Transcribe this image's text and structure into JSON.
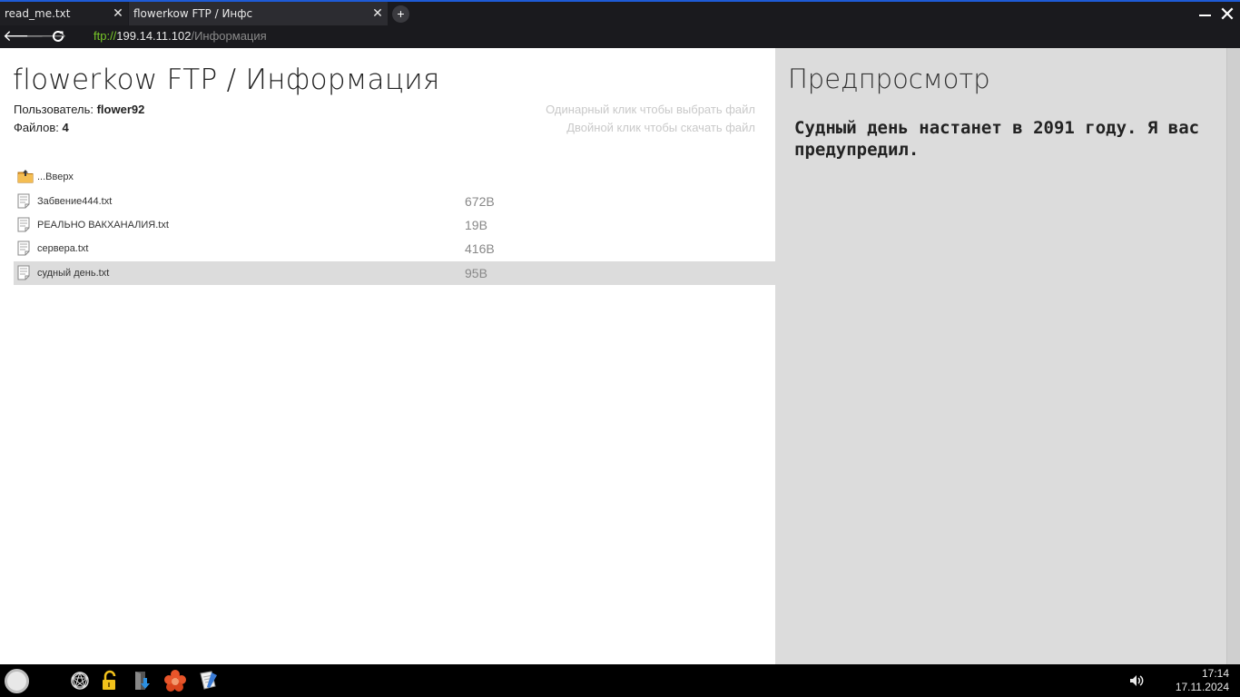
{
  "browser": {
    "tabs": [
      {
        "label": "read_me.txt",
        "active": false
      },
      {
        "label": "flowerkow FTP / Инфс",
        "active": true
      }
    ],
    "new_tab_symbol": "+",
    "close_symbol": "✕",
    "address": {
      "scheme": "ftp://",
      "host": "199.14.11.102",
      "path": "/Информация"
    }
  },
  "page": {
    "title": "flowerkow FTP / Информация",
    "user_label": "Пользователь: ",
    "user_value": "flower92",
    "files_label": "Файлов: ",
    "files_value": "4",
    "hint_single": "Одинарный клик чтобы выбрать файл",
    "hint_double": "Двойной клик чтобы скачать файл",
    "files": [
      {
        "name": "...Вверх",
        "size": "",
        "type": "up",
        "selected": false
      },
      {
        "name": "Забвение444.txt",
        "size": "672B",
        "type": "file",
        "selected": false
      },
      {
        "name": "РЕАЛЬНО ВАКХАНАЛИЯ.txt",
        "size": "19B",
        "type": "file",
        "selected": false
      },
      {
        "name": "сервера.txt",
        "size": "416B",
        "type": "file",
        "selected": false
      },
      {
        "name": "судный день.txt",
        "size": "95B",
        "type": "file",
        "selected": true
      }
    ]
  },
  "preview": {
    "title": "Предпросмотр",
    "text": "Судный день настанет в 2091 году. Я вас предупредил."
  },
  "taskbar": {
    "time": "17:14",
    "date": "17.11.2024"
  },
  "colors": {
    "accent": "#1e5bd6",
    "scheme": "#78c828",
    "selected_row": "#dcdcdc"
  }
}
